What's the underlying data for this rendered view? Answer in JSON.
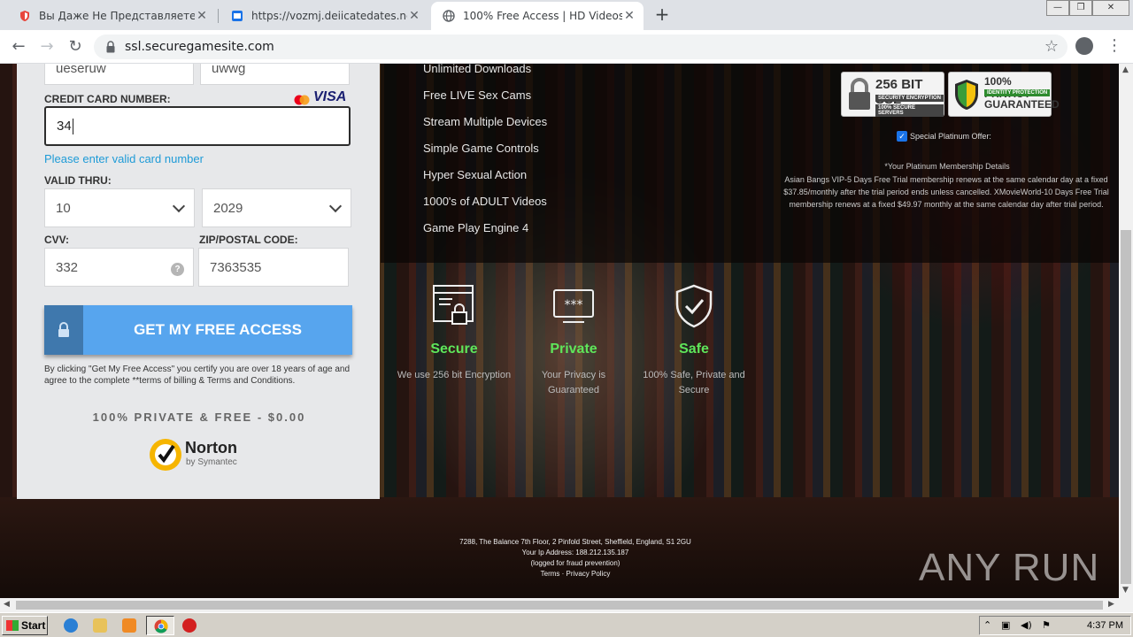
{
  "browser": {
    "tabs": [
      {
        "title": "Вы Даже Не Представляете Что М",
        "active": false
      },
      {
        "title": "https://vozmj.deiicatedates.net/c/d",
        "active": false
      },
      {
        "title": "100% Free Access | HD Videos",
        "active": true
      }
    ],
    "url": "ssl.securegamesite.com"
  },
  "form": {
    "name_first_value": "ueseruw",
    "name_last_value": "uwwg",
    "card_label": "CREDIT CARD NUMBER:",
    "card_brand": "VISA",
    "card_value": "34",
    "card_error": "Please enter valid card number",
    "valid_thru_label": "VALID THRU:",
    "month_value": "10",
    "year_value": "2029",
    "cvv_label": "CVV:",
    "cvv_value": "332",
    "cvv_help": "?",
    "zip_label": "ZIP/POSTAL CODE:",
    "zip_value": "7363535",
    "submit_label": "GET MY FREE ACCESS",
    "terms_text": "By clicking \"Get My Free Access\" you certify you are over 18 years of age and agree to the complete **terms of billing & Terms and Conditions.",
    "price_text": "100% PRIVATE & FREE - $0.00",
    "norton_name": "Norton",
    "norton_by": "by Symantec"
  },
  "features": [
    "Unlimited Downloads",
    "Free LIVE Sex Cams",
    "Stream Multiple Devices",
    "Simple Game Controls",
    "Hyper Sexual Action",
    "1000's of ADULT Videos",
    "Game Play Engine 4"
  ],
  "badges": {
    "ssl_big": "256 BIT SSL",
    "ssl_small1": "SECURITY ENCRYPTION",
    "ssl_small2": "100% SECURE SERVERS",
    "privacy_big1": "100% PRIVACY",
    "privacy_small": "IDENTITY PROTECTION",
    "privacy_big2": "GUARANTEED"
  },
  "offer": {
    "checkbox_label": "Special Platinum Offer:",
    "details_heading": "*Your Platinum Membership Details",
    "details_text": "Asian Bangs VIP-5 Days Free Trial membership renews at the same calendar day at a fixed $37.85/monthly after the trial period ends unless cancelled. XMovieWorld-10 Days Free Trial membership renews at a fixed $49.97 monthly at the same calendar day after trial period."
  },
  "trust": [
    {
      "icon": "browser-lock-icon",
      "title": "Secure",
      "desc": "We use 256 bit Encryption"
    },
    {
      "icon": "password-screen-icon",
      "title": "Private",
      "desc": "Your Privacy is Guaranteed"
    },
    {
      "icon": "shield-check-icon",
      "title": "Safe",
      "desc": "100% Safe, Private and Secure"
    }
  ],
  "footer": {
    "address": "7288, The Balance 7th Floor, 2 Pinfold Street, Sheffield, England, S1 2GU",
    "ip_line": "Your Ip Address: 188.212.135.187",
    "ip_note": "(logged for fraud prevention)",
    "links": "Terms · Privacy Policy"
  },
  "watermark": "ANY RUN",
  "taskbar": {
    "start_label": "Start",
    "clock": "4:37 PM"
  },
  "colors": {
    "accent_blue": "#57a5ee",
    "error_blue": "#1e9bd7",
    "trust_green": "#5fe65a"
  }
}
